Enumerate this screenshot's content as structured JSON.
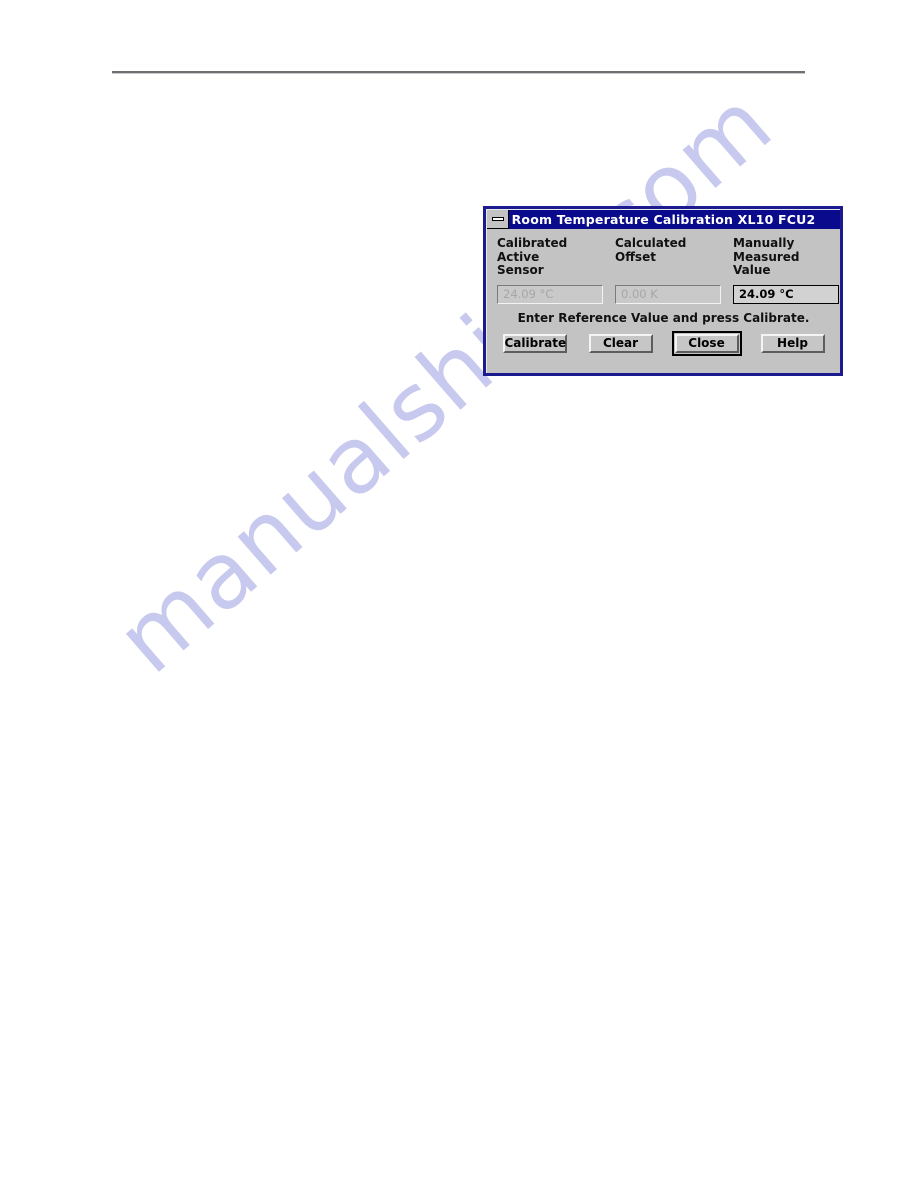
{
  "page": {
    "background_color": "#ffffff",
    "rule_color": "#6e6e72",
    "watermark_text": "manualshive.com",
    "watermark_color": "#c8c9ee"
  },
  "dialog": {
    "title": "Room Temperature Calibration XL10 FCU2",
    "titlebar_color": "#0a0a8c",
    "frame_color": "#1b1b8f",
    "face_color": "#c3c3c3",
    "minimize_icon": "minimize-icon",
    "columns": [
      {
        "label_lines": [
          "Calibrated",
          "Active",
          "Sensor"
        ],
        "field": {
          "value": "24.09 °C",
          "state": "disabled"
        }
      },
      {
        "label_lines": [
          "Calculated",
          "Offset",
          ""
        ],
        "field": {
          "value": "0.00 K",
          "state": "disabled"
        }
      },
      {
        "label_lines": [
          "Manually",
          "Measured",
          "Value"
        ],
        "field": {
          "value": "24.09 °C",
          "state": "active"
        }
      }
    ],
    "hint": "Enter Reference Value and press Calibrate.",
    "buttons": [
      {
        "label": "Calibrate",
        "default": false
      },
      {
        "label": "Clear",
        "default": false
      },
      {
        "label": "Close",
        "default": true
      },
      {
        "label": "Help",
        "default": false
      }
    ]
  }
}
